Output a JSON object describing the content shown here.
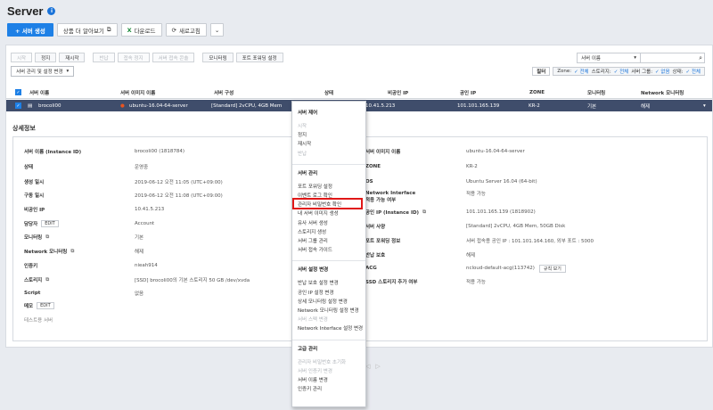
{
  "header": {
    "title": "Server",
    "help_icon": "i"
  },
  "toolbar": {
    "create": "+ 서버 생성",
    "more_info": "상품 더 알아보기",
    "download": "다운로드",
    "refresh": "새로고침"
  },
  "actions": [
    {
      "label": "시작",
      "disabled": true
    },
    {
      "label": "정지",
      "disabled": false
    },
    {
      "label": "재시작",
      "disabled": false
    },
    {
      "label": "반납",
      "disabled": true
    },
    {
      "label": "접속 정지",
      "disabled": true
    },
    {
      "label": "서버 접속 콘솔",
      "disabled": true
    },
    {
      "label": "모니터링",
      "disabled": false
    },
    {
      "label": "포트 포워딩 설정",
      "disabled": false
    }
  ],
  "manage_dropdown": "서버 관리 및 설정 변경",
  "search": {
    "select_value": "서버 이름"
  },
  "filter": {
    "label": "필터",
    "zone_label": "Zone:",
    "zone_val": "✓ 전체",
    "storage_label": "스토리지:",
    "storage_val": "✓ 전체",
    "group_label": "서버 그룹:",
    "group_val": "✓ 없음",
    "state_label": "상태:",
    "state_val": "✓ 전체"
  },
  "table": {
    "columns": [
      "서버 이름",
      "서버 이미지 이름",
      "서버 구성",
      "상태",
      "비공인 IP",
      "공인 IP",
      "ZONE",
      "모니터링",
      "Network 모니터링"
    ],
    "row": {
      "name": "brocoli00",
      "image": "ubuntu-16.04-64-server",
      "spec": "[Standard] 2vCPU, 4GB Mem",
      "private_ip": "10.41.5.213",
      "public_ip": "101.101.165.139",
      "zone": "KR-2",
      "monitoring": "기본",
      "net_monitoring": "해제"
    }
  },
  "detail": {
    "title": "상세정보",
    "left": [
      {
        "k": "서버 이름 (Instance ID)",
        "v": "brocoli00 (1818784)"
      },
      {
        "k": "상태",
        "v": "운영중"
      },
      {
        "k": "생성 일시",
        "v": "2019-06-12 오전 11:05 (UTC+09:00)"
      },
      {
        "k": "구동 일시",
        "v": "2019-06-12 오전 11:08 (UTC+09:00)"
      },
      {
        "k": "비공인 IP",
        "v": "10.41.5.213"
      },
      {
        "k": "담당자",
        "v": "Account",
        "edit": "EDIT"
      },
      {
        "k": "모니터링",
        "v": "기본"
      },
      {
        "k": "Network 모니터링",
        "v": "해제"
      },
      {
        "k": "인증키",
        "v": "nieah914"
      },
      {
        "k": "스토리지",
        "v": "[SSD] brocoli00의 기본 스토리지 50 GB /dev/xvda"
      },
      {
        "k": "Script",
        "v": "없음"
      }
    ],
    "right": [
      {
        "k": "서버 이미지 이름",
        "v": "ubuntu-16.04-64-server"
      },
      {
        "k": "ZONE",
        "v": "KR-2"
      },
      {
        "k": "OS",
        "v": "Ubuntu Server 16.04 (64-bit)"
      },
      {
        "k": "Network Interface",
        "v": "적용 가능"
      },
      {
        "k": "적용 가능 여부",
        "v": ""
      },
      {
        "k": "공인 IP (Instance ID)",
        "v": "101.101.165.139 (1818902)"
      },
      {
        "k": "서버 사양",
        "v": "[Standard] 2vCPU, 4GB Mem, 50GB Disk"
      },
      {
        "k": "포트 포워딩 정보",
        "v": "서버 접속용 공인 IP : 101.101.164.160, 외부 포트 : 5000"
      },
      {
        "k": "반납 보호",
        "v": "해제"
      },
      {
        "k": "ACG",
        "v": "ncloud-default-acg(113742)",
        "btn": "규칙 보기"
      },
      {
        "k": "SSD 스토리지 추가 여부",
        "v": "적용 가능"
      }
    ],
    "memo_label": "메모",
    "memo_edit": "EDIT",
    "memo_value": "테스트용 서버"
  },
  "context_menu": {
    "sections": [
      {
        "title": "서버 제어",
        "items": [
          {
            "label": "시작",
            "disabled": true
          },
          {
            "label": "정지",
            "disabled": false
          },
          {
            "label": "재시작",
            "disabled": false
          },
          {
            "label": "반납",
            "disabled": true
          }
        ]
      },
      {
        "title": "서버 관리",
        "items": [
          {
            "label": "포트 포워딩 설정",
            "disabled": false
          },
          {
            "label": "이벤트 로그 확인",
            "disabled": false
          },
          {
            "label": "관리자 비밀번호 확인",
            "disabled": false,
            "highlight": true
          },
          {
            "label": "내 서버 이미지 생성",
            "disabled": false
          },
          {
            "label": "유사 서버 생성",
            "disabled": false
          },
          {
            "label": "스토리지 생성",
            "disabled": false
          },
          {
            "label": "서버 그룹 관리",
            "disabled": false
          },
          {
            "label": "서버 접속 가이드",
            "disabled": false
          }
        ]
      },
      {
        "title": "서버 설정 변경",
        "items": [
          {
            "label": "반납 보호 설정 변경",
            "disabled": false
          },
          {
            "label": "공인 IP 설정 변경",
            "disabled": false
          },
          {
            "label": "상세 모니터링 설정 변경",
            "disabled": false
          },
          {
            "label": "Network 모니터링 설정 변경",
            "disabled": false
          },
          {
            "label": "서버 스펙 변경",
            "disabled": true
          },
          {
            "label": "Network Interface 설정 변경",
            "disabled": false
          }
        ]
      },
      {
        "title": "고급 관리",
        "items": [
          {
            "label": "관리자 비밀번호 초기화",
            "disabled": true
          },
          {
            "label": "서버 인증키 변경",
            "disabled": true
          },
          {
            "label": "서버 이름 변경",
            "disabled": false
          },
          {
            "label": "인증키 관리",
            "disabled": false
          }
        ]
      }
    ]
  }
}
